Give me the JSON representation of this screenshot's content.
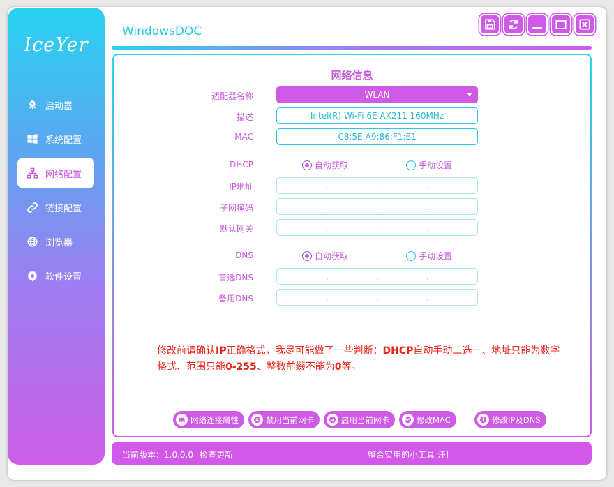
{
  "app": {
    "logo_text": "IceYer",
    "title": "WindowsDOC"
  },
  "toolbar": [
    {
      "name": "save-icon"
    },
    {
      "name": "refresh-icon"
    },
    {
      "name": "minimize-icon"
    },
    {
      "name": "maximize-icon"
    },
    {
      "name": "close-icon"
    }
  ],
  "sidebar": {
    "items": [
      {
        "label": "启动器",
        "icon": "rocket-icon",
        "active": false
      },
      {
        "label": "系统配置",
        "icon": "windows-icon",
        "active": false
      },
      {
        "label": "网络配置",
        "icon": "network-icon",
        "active": true
      },
      {
        "label": "链接配置",
        "icon": "link-icon",
        "active": false
      },
      {
        "label": "浏览器",
        "icon": "globe-icon",
        "active": false
      },
      {
        "label": "软件设置",
        "icon": "gear-icon",
        "active": false
      }
    ]
  },
  "panel": {
    "title": "网络信息",
    "adapter": {
      "label": "适配器名称",
      "value": "WLAN"
    },
    "desc": {
      "label": "描述",
      "value": "Intel(R) Wi-Fi 6E AX211 160MHz"
    },
    "mac": {
      "label": "MAC",
      "value": "C8:5E:A9:86:F1:E1"
    },
    "dhcp": {
      "label": "DHCP",
      "auto": "自动获取",
      "manual": "手动设置",
      "selected": "auto"
    },
    "ip": {
      "label": "IP地址"
    },
    "mask": {
      "label": "子网掩码"
    },
    "gateway": {
      "label": "默认网关"
    },
    "dns": {
      "label": "DNS",
      "auto": "自动获取",
      "manual": "手动设置",
      "selected": "auto"
    },
    "dns1": {
      "label": "首选DNS"
    },
    "dns2": {
      "label": "备用DNS"
    },
    "ip_dot": ".",
    "notice": {
      "p1": "修改前请确认",
      "b1": "IP",
      "p2": "正确格式，我尽可能做了一些判断：",
      "b2": "DHCP",
      "p3": "自动手动二选一、地址只能为数字格式、范围只能",
      "b3": "0-255",
      "p4": "、整数前缀不能为",
      "b4": "0",
      "p5": "等。"
    }
  },
  "actions": [
    {
      "label": "网络连接属性",
      "icon": "ethernet-icon"
    },
    {
      "label": "禁用当前网卡",
      "icon": "disable-icon"
    },
    {
      "label": "启用当前网卡",
      "icon": "check-icon"
    },
    {
      "label": "修改MAC",
      "icon": "mac-icon"
    },
    {
      "label": "修改IP及DNS",
      "icon": "info-icon"
    }
  ],
  "status": {
    "version": "当前版本：1.0.0.0",
    "check_update": "检查更新",
    "slogan": "整合实用的小工具 汪!"
  },
  "colors": {
    "accent": "#cf5ae6",
    "cyan": "#27c9e6",
    "notice": "#e8251a"
  }
}
